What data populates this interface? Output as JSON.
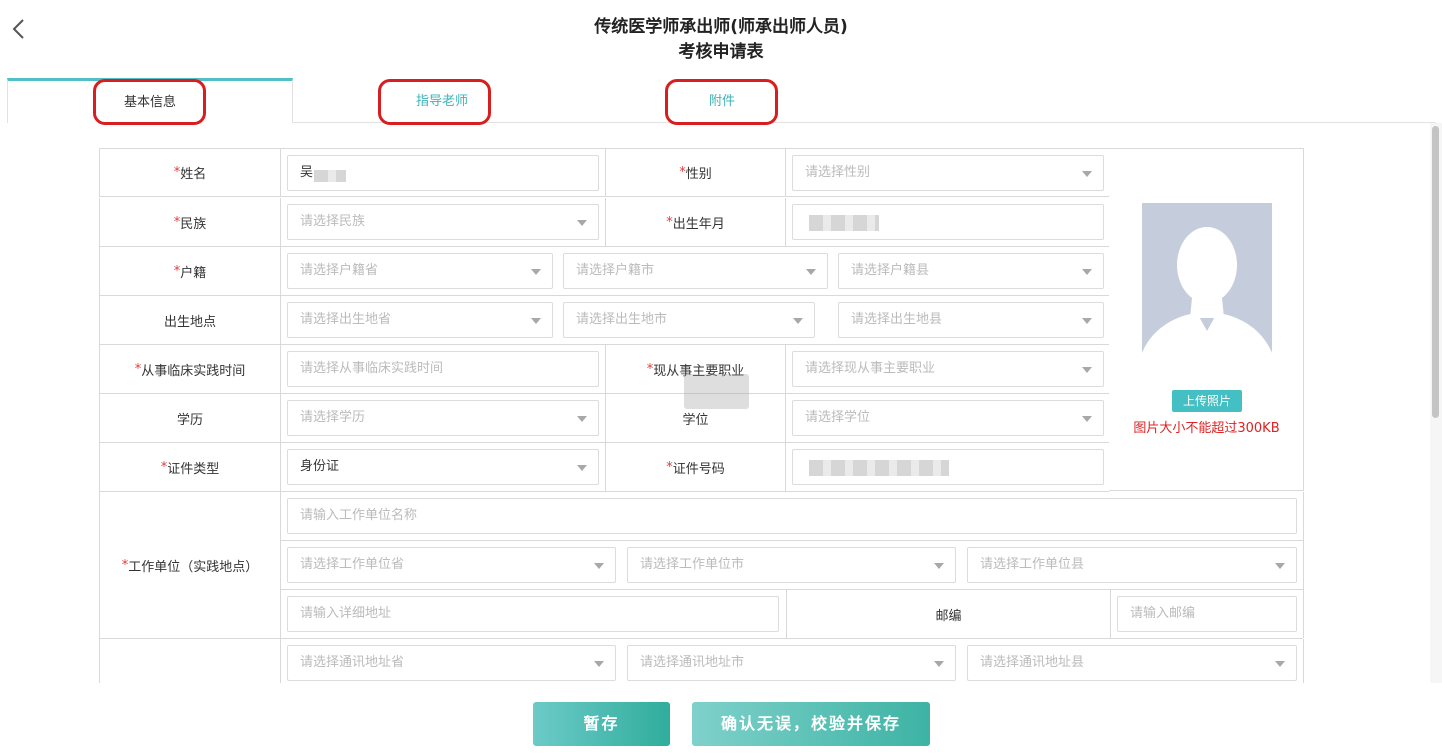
{
  "header": {
    "title_line1": "传统医学师承出师(师承出师人员)",
    "title_line2": "考核申请表"
  },
  "tabs": [
    {
      "label": "基本信息"
    },
    {
      "label": "指导老师"
    },
    {
      "label": "附件"
    }
  ],
  "form": {
    "name": {
      "required": "*",
      "label": "姓名",
      "value": "吴"
    },
    "gender": {
      "required": "*",
      "label": "性别",
      "placeholder": "请选择性别"
    },
    "ethnicity": {
      "required": "*",
      "label": "民族",
      "placeholder": "请选择民族"
    },
    "birth": {
      "required": "*",
      "label": "出生年月"
    },
    "household": {
      "required": "*",
      "label": "户籍",
      "province": "请选择户籍省",
      "city": "请选择户籍市",
      "county": "请选择户籍县"
    },
    "birthplace": {
      "label": "出生地点",
      "province": "请选择出生地省",
      "city": "请选择出生地市",
      "county": "请选择出生地县"
    },
    "practice_time": {
      "required": "*",
      "label": "从事临床实践时间",
      "placeholder": "请选择从事临床实践时间"
    },
    "occupation": {
      "required": "*",
      "label": "现从事主要职业",
      "placeholder": "请选择现从事主要职业"
    },
    "education": {
      "label": "学历",
      "placeholder": "请选择学历"
    },
    "degree": {
      "label": "学位",
      "placeholder": "请选择学位"
    },
    "id_type": {
      "required": "*",
      "label": "证件类型",
      "value": "身份证"
    },
    "id_number": {
      "required": "*",
      "label": "证件号码"
    },
    "workplace": {
      "required": "*",
      "label": "工作单位（实践地点）",
      "name_placeholder": "请输入工作单位名称",
      "province": "请选择工作单位省",
      "city": "请选择工作单位市",
      "county": "请选择工作单位县",
      "address_placeholder": "请输入详细地址",
      "postcode_label": "邮编",
      "postcode_placeholder": "请输入邮编"
    },
    "mailing": {
      "province": "请选择通讯地址省",
      "city": "请选择通讯地址市",
      "county": "请选择通讯地址县"
    },
    "photo": {
      "upload_label": "上传照片",
      "size_note": "图片大小不能超过300KB"
    }
  },
  "footer": {
    "save_label": "暂存",
    "confirm_label": "确认无误，校验并保存"
  },
  "colors": {
    "accent": "#44c0c4",
    "required": "#e03a3a",
    "annotation_box": "#d81e1e",
    "warning_text": "#e02222"
  }
}
